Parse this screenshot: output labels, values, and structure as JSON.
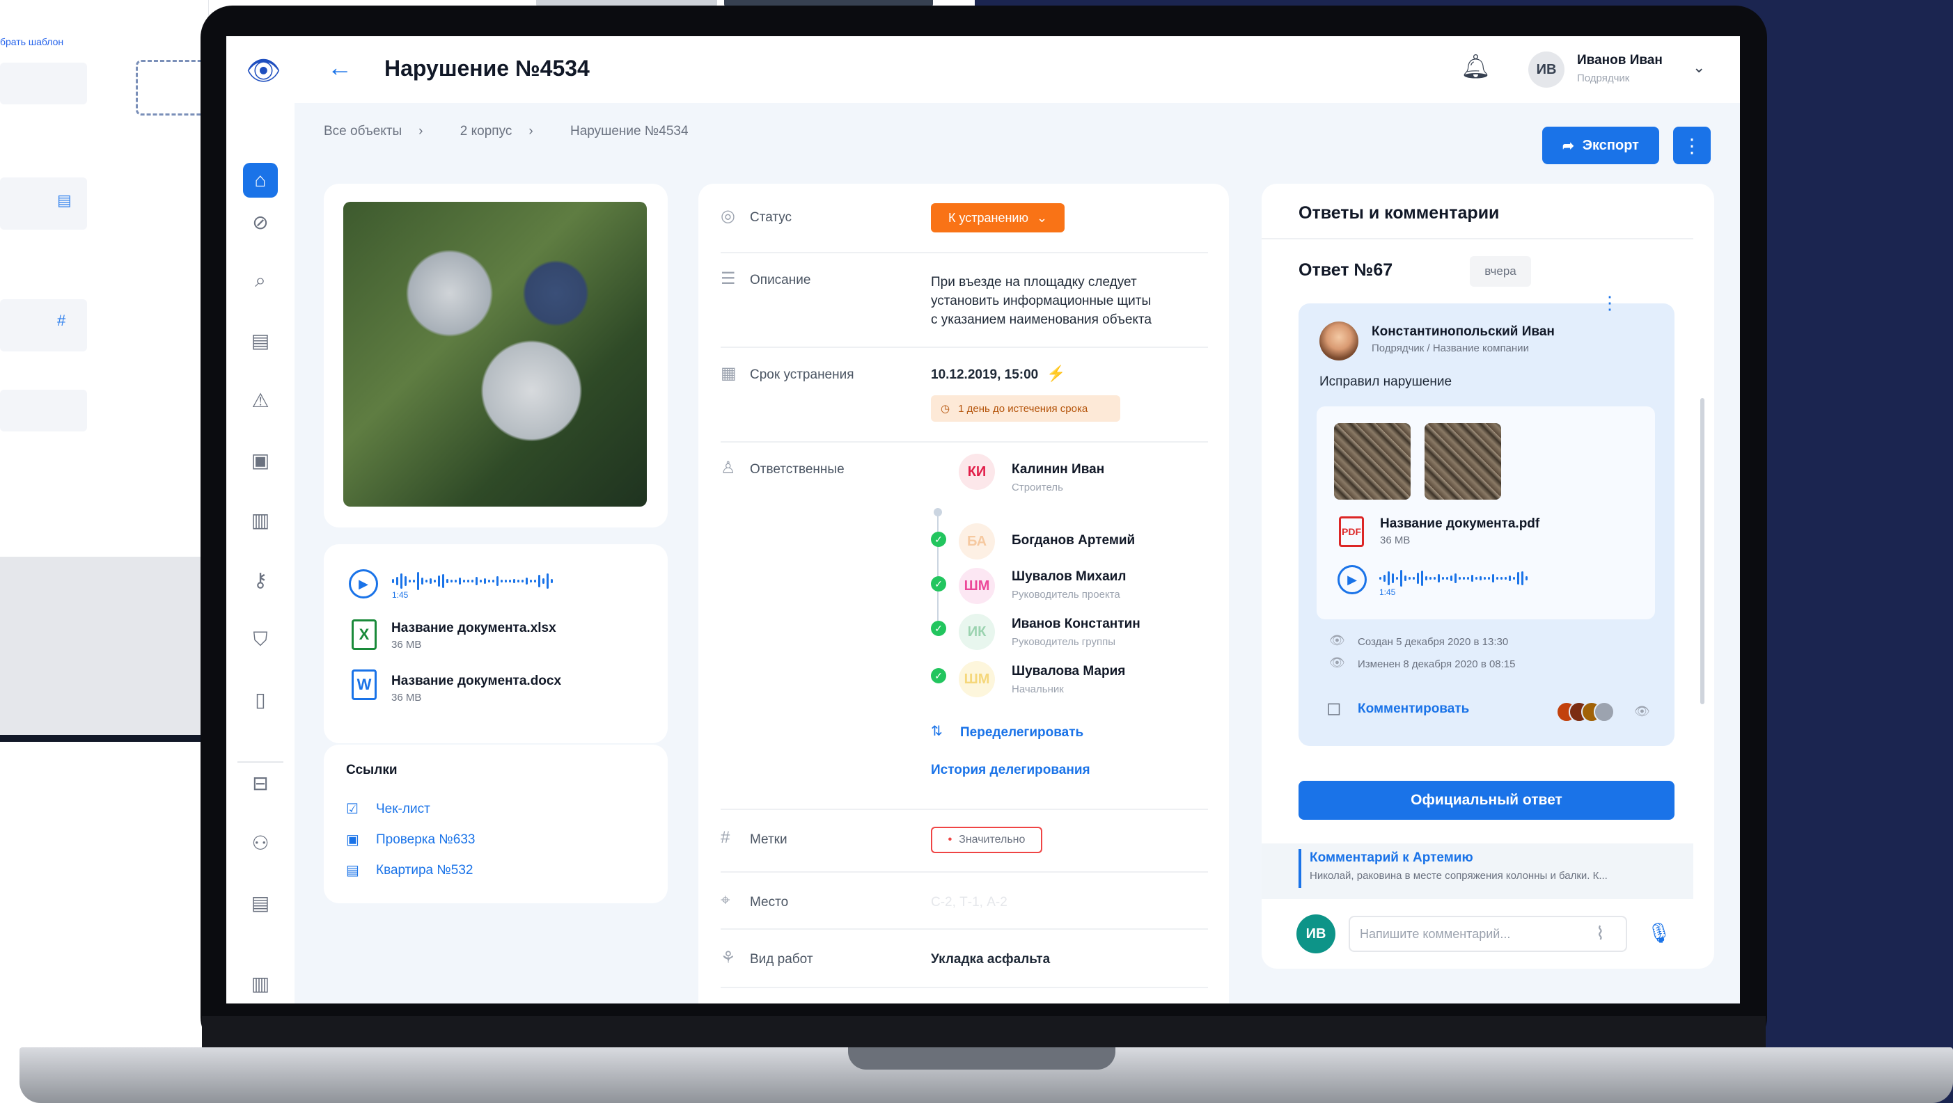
{
  "background_app": {
    "select_template_label": "брать шаблон"
  },
  "app": {
    "title": "Нарушение №4534"
  },
  "user": {
    "initials": "ИВ",
    "name": "Иванов Иван",
    "role": "Подрядчик"
  },
  "breadcrumb": [
    "Все объекты",
    "2 корпус",
    "Нарушение №4534"
  ],
  "export_label": "Экспорт",
  "fields": {
    "status_label": "Статус",
    "status_value": "К устранению",
    "description_label": "Описание",
    "description_lines": [
      "При въезде на площадку следует",
      "установить информационные щиты",
      "с указанием наименования объекта"
    ],
    "deadline_label": "Срок устранения",
    "deadline_value": "10.12.2019, 15:00",
    "deadline_badge": "1 день до истечения срока",
    "responsible_label": "Ответственные",
    "tags_label": "Метки",
    "tag_value": "Значительно",
    "place_label": "Место",
    "place_value": "С-2, Т-1, А-2",
    "worktype_label": "Вид работ",
    "worktype_value": "Укладка асфальта"
  },
  "responsible": [
    {
      "initials": "КИ",
      "name": "Калинин Иван",
      "role": "Строитель",
      "color": "#e11d48",
      "bg": "#fce7ea",
      "done": false
    },
    {
      "initials": "БА",
      "name": "Богданов Артемий",
      "role": "",
      "color": "#f6c9a0",
      "bg": "#fdf0e4",
      "done": true
    },
    {
      "initials": "ШМ",
      "name": "Шувалов Михаил",
      "role": "Руководитель проекта",
      "color": "#ec4899",
      "bg": "#fce7f3",
      "done": true
    },
    {
      "initials": "ИК",
      "name": "Иванов Константин",
      "role": "Руководитель группы",
      "color": "#9bd3b0",
      "bg": "#e8f6ee",
      "done": true
    },
    {
      "initials": "ШМ",
      "name": "Шувалова Мария",
      "role": "Начальник",
      "color": "#f5d77a",
      "bg": "#fdf6dc",
      "done": true
    }
  ],
  "redelegate_label": "Переделегировать",
  "history_label": "История делегирования",
  "audio": {
    "duration": "1:45"
  },
  "files": [
    {
      "type": "xlsx",
      "glyph": "X",
      "name": "Название документа.xlsx",
      "size": "36 MB"
    },
    {
      "type": "docx",
      "glyph": "W",
      "name": "Название документа.docx",
      "size": "36 MB"
    }
  ],
  "links": {
    "header": "Ссылки",
    "items": [
      "Чек-лист",
      "Проверка №633",
      "Квартира №532"
    ]
  },
  "comments": {
    "header": "Ответы и комментарии",
    "answer_no": "Ответ №67",
    "answer_date": "вчера",
    "author_name": "Константинопольский Иван",
    "author_role": "Подрядчик / Название компании",
    "text": "Исправил нарушение",
    "pdf_glyph": "PDF",
    "pdf_name": "Название документа.pdf",
    "pdf_size": "36 MB",
    "audio_duration": "1:45",
    "created": "Создан 5 декабря 2020 в 13:30",
    "changed": "Изменен 8 декабря 2020 в 08:15",
    "comment_action": "Комментировать",
    "official_reply": "Официальный ответ",
    "reply_header": "Комментарий к Артемию",
    "reply_text": "Николай, раковина в месте сопряжения колонны и балки. К...",
    "input_placeholder": "Напишите комментарий..."
  }
}
